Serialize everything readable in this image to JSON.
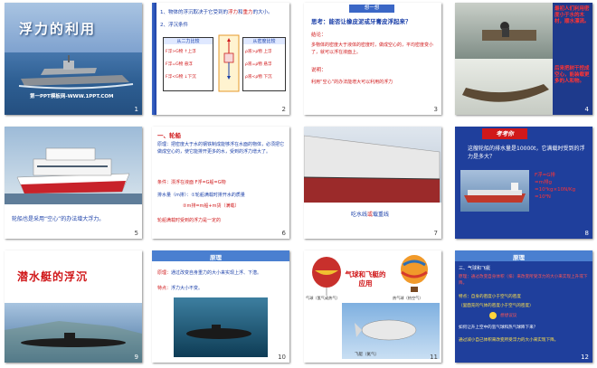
{
  "slides": [
    {
      "num": "1",
      "title": "浮力的利用",
      "footer": "第一PPT模板网-WWW.1PPT.COM"
    },
    {
      "num": "2",
      "line1": "1、物体的浮沉取决于它受到的",
      "word1": "浮力",
      "and": "和",
      "word2": "重力",
      "tail": "的大小。",
      "line2": "2、浮沉条件",
      "box_left_title": "从二力比较",
      "box_right_title": "从密度比较",
      "left_rows": [
        "F浮>G物 ↑上浮",
        "F浮=G物 悬浮",
        "F浮<G物 ↓下沉"
      ],
      "right_rows": [
        "ρ液>ρ物 上浮",
        "ρ液=ρ物 悬浮",
        "ρ液<ρ物 下沉"
      ],
      "f_label": "F浮",
      "g_label": "G"
    },
    {
      "num": "3",
      "tag": "想一想",
      "question": "思考：能否让橡皮泥或牙膏皮浮起来？",
      "label1": "结论：",
      "text1": "多物体的密度大于液体的密度时，做成空心的，平均密度变小了，就可以浮在液面上。",
      "label2": "说明：",
      "text2": "利用“空心”的办法能增大可以利用的浮力"
    },
    {
      "num": "4",
      "top_text": "最初人们利用密度小于水的木材，顺水漂流。",
      "bottom_text": "后来把树干挖成空心，能装载更多的人和物。"
    },
    {
      "num": "5",
      "caption": "轮船也是采用“空心”的办法增大浮力。"
    },
    {
      "num": "6",
      "title": "一、轮船",
      "line1": "原理：把密度大于水的钢铁制成能够浮在水面的物体，必须把它做成空心的，使它能排开更多的水，受到的浮力增大了。",
      "line2": "条件：漂浮在液面  F浮=G船=G物",
      "line3": "排水量（m排）：①轮船满载时排开水的质量",
      "line4": "②m排=m船+m货（满载）",
      "note": "轮船满载时受到的浮力是一定的"
    },
    {
      "num": "7",
      "caption_a": "吃水线",
      "caption_b": "或",
      "caption_c": "载重线"
    },
    {
      "num": "8",
      "title": "考考你",
      "question": "这艘轮船的排水量是10000t，它满载时受到的浮力是多大？",
      "formula_lines": [
        "F浮=G排",
        "=m排g",
        "=10⁴kg×10N/Kg",
        "=10⁸N"
      ]
    },
    {
      "num": "9",
      "title": "潜水艇的浮沉"
    },
    {
      "num": "10",
      "header": "原理",
      "line1_label": "原理：",
      "line1": "通过改变自身重力的大小来实现上浮、下潜。",
      "line2_label": "特点：",
      "line2": "浮力大小不变。"
    },
    {
      "num": "11",
      "title": "气球和飞艇的应用",
      "cap1": "气球（氢气或热气）",
      "cap2": "热气球（热空气）",
      "cap3": "飞艇（氦气）"
    },
    {
      "num": "12",
      "header": "原理",
      "heading": "三、气球和飞艇",
      "line1": "原理：通过改变自身体积（排）来改变所受浮力的大小来实现上升或下降。",
      "line2": "特点：自身的密度小于空气的密度",
      "line3": "（里面充的气体的密度小于空气的密度）",
      "line4": "想想议议",
      "line5": "如何让升上空中的氢气球和热气球降下来？",
      "line6": "通过减小自己体积来改变所受浮力的大小来实现下降。"
    }
  ]
}
